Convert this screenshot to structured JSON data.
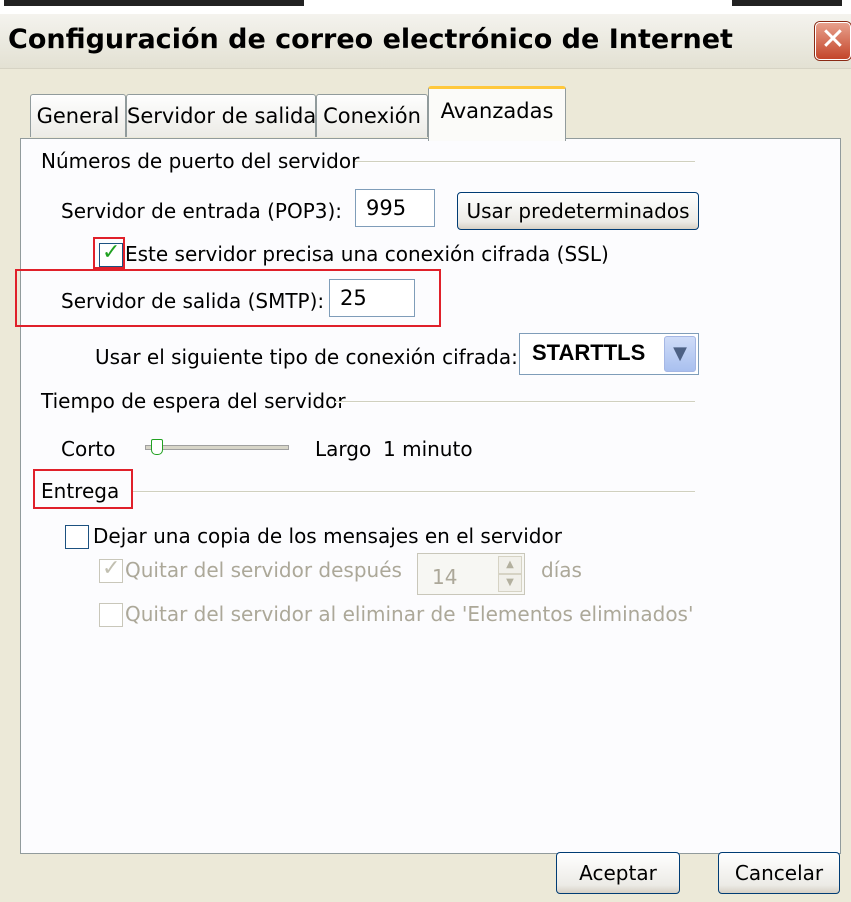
{
  "window": {
    "title": "Configuración de correo electrónico de Internet",
    "close_symbol": "✕"
  },
  "tabs": [
    {
      "label": "General"
    },
    {
      "label": "Servidor de salida"
    },
    {
      "label": "Conexión"
    },
    {
      "label": "Avanzadas"
    }
  ],
  "active_tab": "Avanzadas",
  "ports_group": {
    "title": "Números de puerto del servidor",
    "incoming_label": "Servidor de entrada (POP3):",
    "incoming_value": "995",
    "defaults_button": "Usar predeterminados",
    "ssl_label": "Este servidor precisa una conexión cifrada (SSL)",
    "ssl_checked": true,
    "outgoing_label": "Servidor de salida (SMTP):",
    "outgoing_value": "25",
    "encryption_label": "Usar el siguiente tipo de conexión cifrada:",
    "encryption_value": "STARTTLS"
  },
  "timeout_group": {
    "title": "Tiempo de espera del servidor",
    "short_label": "Corto",
    "long_label": "Largo",
    "value_text": "1 minuto",
    "slider_fraction": 0.0
  },
  "delivery_group": {
    "title": "Entrega",
    "leave_copy_label": "Dejar una copia de los mensajes en el servidor",
    "leave_copy_checked": false,
    "remove_after_label": "Quitar del servidor después",
    "remove_after_checked": true,
    "remove_after_days": "14",
    "days_label": "días",
    "remove_on_delete_label": "Quitar del servidor al eliminar de 'Elementos eliminados'",
    "remove_on_delete_checked": false
  },
  "buttons": {
    "ok": "Aceptar",
    "cancel": "Cancelar"
  },
  "annotation_color": "#e0202a",
  "check_symbol": "✓",
  "dropdown_icon": "chevron-down-icon",
  "spin_up": "▲",
  "spin_down": "▼"
}
